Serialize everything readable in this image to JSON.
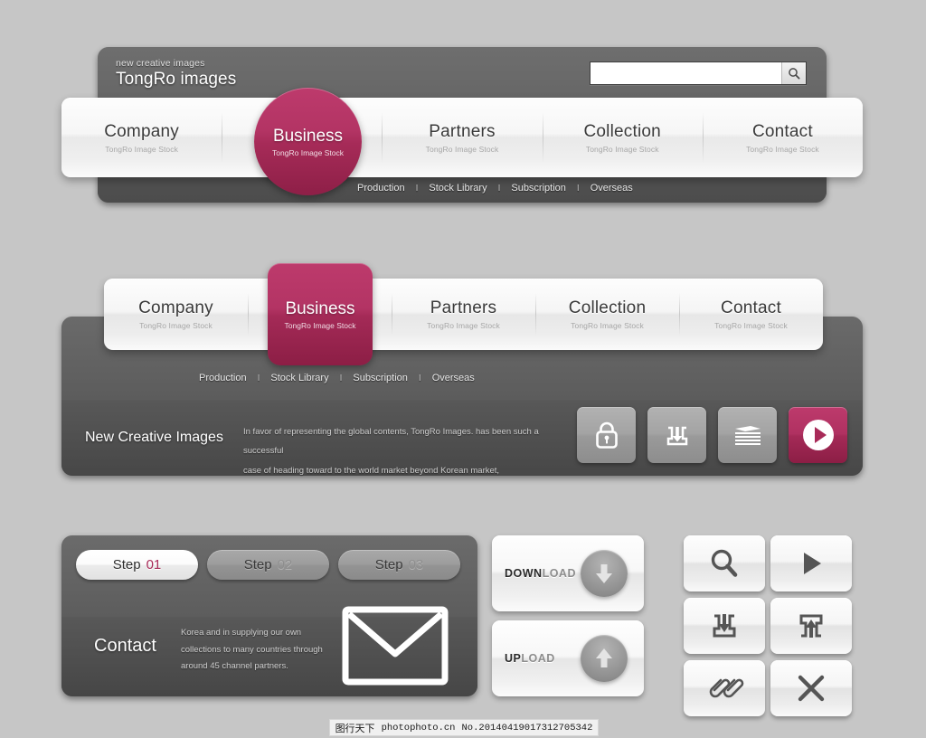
{
  "page": {
    "background_color": "#c6c6c6",
    "accent_color": "#a82a58",
    "dark_panel_color": "#5c5c5c"
  },
  "header": {
    "tagline": "new creative images",
    "title": "TongRo images",
    "search": {
      "value": "",
      "placeholder": "",
      "icon": "search-icon"
    }
  },
  "nav_subtitle": "TongRo Image Stock",
  "nav_primary": [
    {
      "label": "Company",
      "subtitle": "TongRo Image Stock",
      "active": false
    },
    {
      "label": "Business",
      "subtitle": "TongRo Image Stock",
      "active": true
    },
    {
      "label": "Partners",
      "subtitle": "TongRo Image Stock",
      "active": false
    },
    {
      "label": "Collection",
      "subtitle": "TongRo Image Stock",
      "active": false
    },
    {
      "label": "Contact",
      "subtitle": "TongRo Image Stock",
      "active": false
    }
  ],
  "subnav": {
    "separator": "I",
    "items": [
      "Production",
      "Stock Library",
      "Subscription",
      "Overseas"
    ]
  },
  "promo": {
    "title": "New Creative Images",
    "body_line1": "In favor of representing the global contents, TongRo Images. has been such a successful",
    "body_line2": "case of heading toward to the world market beyond Korean market,",
    "icons": [
      {
        "name": "lock-icon",
        "accent": false
      },
      {
        "name": "download-icon",
        "accent": false
      },
      {
        "name": "layers-icon",
        "accent": false
      },
      {
        "name": "play-icon",
        "accent": true
      }
    ]
  },
  "steps": [
    {
      "label": "Step",
      "number": "01",
      "active": true
    },
    {
      "label": "Step",
      "number": "02",
      "active": false
    },
    {
      "label": "Step",
      "number": "03",
      "active": false
    }
  ],
  "contact": {
    "title": "Contact",
    "body_line1": "Korea and in supplying our own",
    "body_line2": "collections to many countries through",
    "body_line3": "around 45 channel partners.",
    "icon": "envelope-icon"
  },
  "actions": [
    {
      "strong": "DOWN",
      "rest": "LOAD",
      "icon": "arrow-down-circle-icon"
    },
    {
      "strong": "UP",
      "rest": "LOAD",
      "icon": "arrow-up-circle-icon"
    }
  ],
  "icon_grid": [
    {
      "name": "search-icon"
    },
    {
      "name": "play-icon"
    },
    {
      "name": "download-icon"
    },
    {
      "name": "upload-icon"
    },
    {
      "name": "paperclip-icon"
    },
    {
      "name": "close-icon"
    }
  ],
  "watermark": {
    "site_cn": "图行天下",
    "site": "photophoto.cn",
    "number": "No.20140419017312705342"
  }
}
